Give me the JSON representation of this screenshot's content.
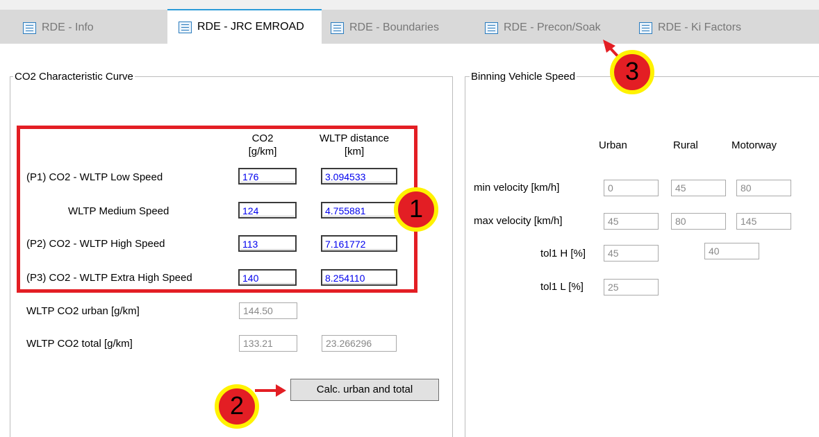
{
  "tabs": [
    {
      "label": "RDE - Info"
    },
    {
      "label": "RDE - JRC EMROAD"
    },
    {
      "label": "RDE - Boundaries"
    },
    {
      "label": "RDE - Precon/Soak"
    },
    {
      "label": "RDE - Ki Factors"
    }
  ],
  "co2_group": {
    "title": "CO2 Characteristic Curve",
    "col_co2_header_line1": "CO2",
    "col_co2_header_line2": "[g/km]",
    "col_dist_header_line1": "WLTP distance",
    "col_dist_header_line2": "[km]",
    "rows": [
      {
        "label": "(P1) CO2 - WLTP Low Speed",
        "co2": "176",
        "distance": "3.094533"
      },
      {
        "label": "WLTP Medium Speed",
        "co2": "124",
        "distance": "4.755881"
      },
      {
        "label": "(P2) CO2 - WLTP High Speed",
        "co2": "113",
        "distance": "7.161772"
      },
      {
        "label": "(P3) CO2 - WLTP Extra High Speed",
        "co2": "140",
        "distance": "8.254110"
      }
    ],
    "urban_label": "WLTP CO2 urban [g/km]",
    "urban_value": "144.50",
    "total_label": "WLTP CO2 total [g/km]",
    "total_value": "133.21",
    "total_distance": "23.266296",
    "calc_button": "Calc. urban and total"
  },
  "binning_group": {
    "title": "Binning Vehicle Speed",
    "col_urban": "Urban",
    "col_rural": "Rural",
    "col_motorway": "Motorway",
    "min_label": "min velocity [km/h]",
    "min_urban": "0",
    "min_rural": "45",
    "min_motorway": "80",
    "max_label": "max velocity [km/h]",
    "max_urban": "45",
    "max_rural": "80",
    "max_motorway": "145",
    "tol1h_label": "tol1 H [%]",
    "tol1h_a": "45",
    "tol1h_b": "40",
    "tol1l_label": "tol1 L [%]",
    "tol1l_a": "25"
  },
  "annotations": {
    "badge1": "1",
    "badge2": "2",
    "badge3": "3",
    "color_red": "#e31e24",
    "color_yellow": "#fff200"
  }
}
